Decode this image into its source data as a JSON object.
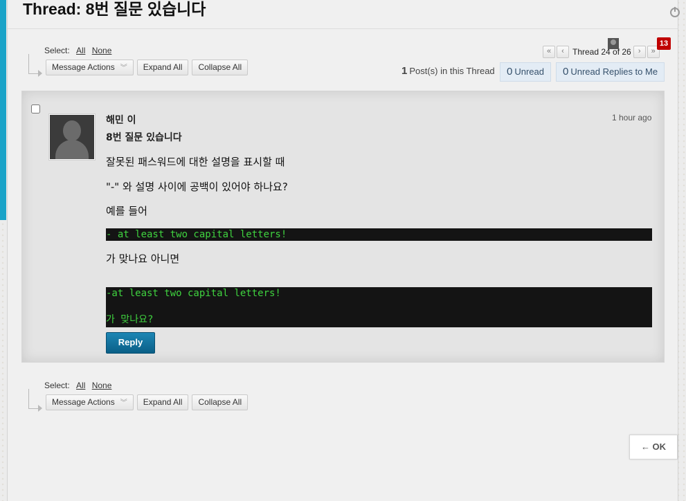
{
  "page": {
    "title": "Thread: 8번 질문 있습니다"
  },
  "toolbar": {
    "select_label": "Select:",
    "select_all": "All",
    "select_none": "None",
    "message_actions": "Message Actions",
    "expand_all": "Expand All",
    "collapse_all": "Collapse All"
  },
  "pager": {
    "thread_position": "Thread 24 of 26",
    "notification_count": "13"
  },
  "stats": {
    "posts_count": "1",
    "posts_label": "Post(s) in this Thread",
    "unread_count": "0",
    "unread_label": "Unread",
    "unread_replies_count": "0",
    "unread_replies_label": "Unread Replies to Me"
  },
  "message": {
    "author": "해민 이",
    "time": "1 hour ago",
    "subject": "8번 질문 있습니다",
    "lines": [
      "잘못된 패스워드에 대한 설명을 표시할 때",
      "\"-\" 와 설명 사이에 공백이 있어야 하나요?",
      "예를 들어",
      "가 맞나요 아니면"
    ],
    "code1": "- at least two capital letters!",
    "code2_line1": "-at least two capital letters!",
    "code2_line2": "가 맞나요?",
    "reply_label": "Reply"
  },
  "footer": {
    "ok_label": "← OK"
  },
  "colors": {
    "accent": "#1aa3c8",
    "reply_button": "#0f6f9a",
    "code_background": "#141414",
    "code_text": "#3fd33f",
    "badge": "#c00000",
    "unread_pill": "#e3ecf5"
  }
}
